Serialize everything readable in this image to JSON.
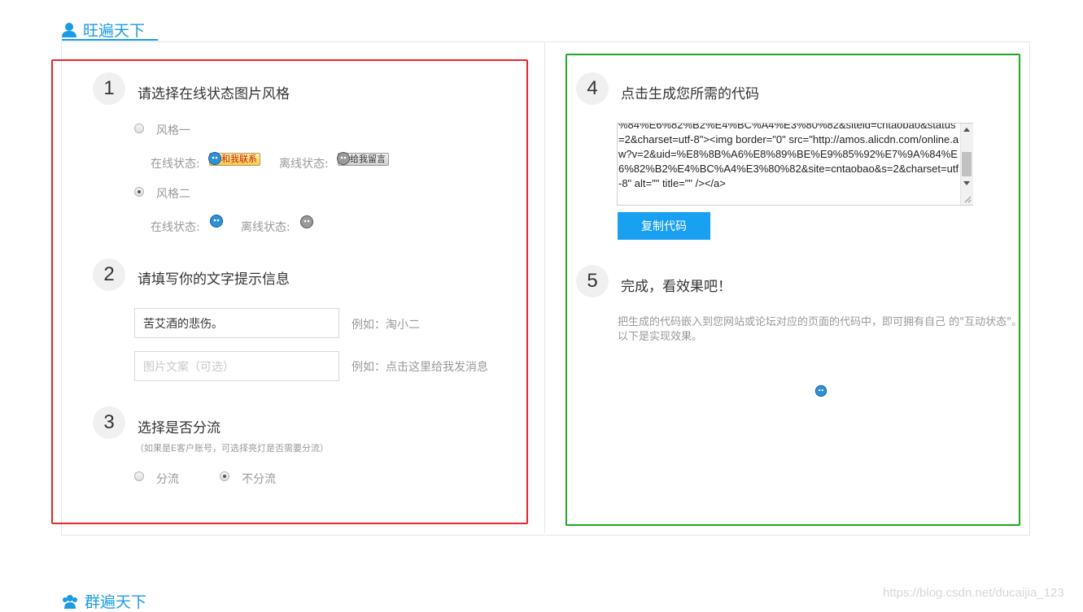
{
  "sections": {
    "wangwang_title": "旺遍天下",
    "group_title": "群遍天下"
  },
  "step1": {
    "number": "1",
    "title": "请选择在线状态图片风格",
    "style1_label": "风格一",
    "style2_label": "风格二",
    "online_label": "在线状态:",
    "offline_label": "离线状态:",
    "online_badge": "和我联系",
    "offline_badge": "给我留言"
  },
  "step2": {
    "number": "2",
    "title": "请填写你的文字提示信息",
    "text_value": "苦艾酒的悲伤。",
    "text_example": "例如：淘小二",
    "image_placeholder": "图片文案（可选）",
    "image_example": "例如：点击这里给我发消息"
  },
  "step3": {
    "number": "3",
    "title": "选择是否分流",
    "subtitle": "（如果是E客户账号，可选择亮灯是否需要分流）",
    "option_split": "分流",
    "option_nosplit": "不分流"
  },
  "step4": {
    "number": "4",
    "title": "点击生成您所需的代码",
    "code_text": "%84%E6%82%B2%E4%BC%A4%E3%80%82&siteid=cntaobao&status=2&charset=utf-8\"><img border=\"0\" src=\"http://amos.alicdn.com/online.aw?v=2&uid=%E8%8B%A6%E8%89%BE%E9%85%92%E7%9A%84%E6%82%B2%E4%BC%A4%E3%80%82&site=cntaobao&s=2&charset=utf-8\" alt=\"\" title=\"\" /></a>",
    "copy_button": "复制代码"
  },
  "step5": {
    "number": "5",
    "title": "完成，看效果吧！",
    "description": "把生成的代码嵌入到您网站或论坛对应的页面的代码中，即可拥有自己 的\"互动状态\"。以下是实现效果。"
  },
  "state": {
    "style_selected": "风格二",
    "split_selected": "不分流"
  },
  "watermark": "https://blog.csdn.net/ducaijia_123",
  "colors": {
    "accent": "#1a9be6",
    "red_highlight": "#e8262a",
    "green_highlight": "#22a822",
    "copy_button": "#19a0f0"
  },
  "icons": {
    "section_user": "user-icon",
    "section_group": "group-icon",
    "wangwang_online": "wangwang-online-icon",
    "wangwang_offline": "wangwang-offline-icon"
  }
}
